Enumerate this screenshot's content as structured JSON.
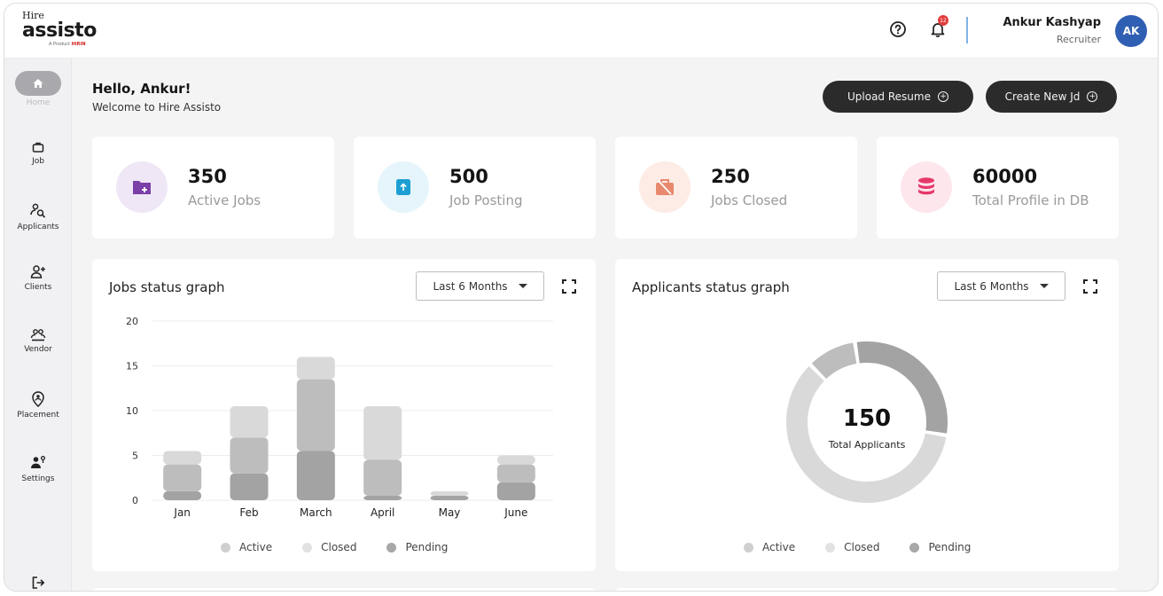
{
  "brand": {
    "hire": "Hire",
    "name": "assisto",
    "tagline_prefix": "A Product",
    "tagline_brand": "HIRIN"
  },
  "header": {
    "notification_count": "12",
    "user_name": "Ankur Kashyap",
    "user_role": "Recruiter",
    "avatar_initials": "AK"
  },
  "sidebar": {
    "items": [
      {
        "label": "Home",
        "icon": "home-icon"
      },
      {
        "label": "Job",
        "icon": "briefcase-icon"
      },
      {
        "label": "Applicants",
        "icon": "applicants-search-icon"
      },
      {
        "label": "Clients",
        "icon": "add-user-icon"
      },
      {
        "label": "Vendor",
        "icon": "group-icon"
      },
      {
        "label": "Placement",
        "icon": "placement-pin-icon"
      },
      {
        "label": "Settings",
        "icon": "user-settings-icon"
      }
    ],
    "logout_icon": "logout-icon"
  },
  "greeting": {
    "hello": "Hello, Ankur!",
    "welcome": "Welcome to Hire Assisto"
  },
  "actions": {
    "upload": "Upload Resume",
    "create": "Create New Jd"
  },
  "stats": [
    {
      "value": "350",
      "label": "Active Jobs",
      "color": "#efe7f6",
      "icon_color": "#7b3fa8"
    },
    {
      "value": "500",
      "label": "Job Posting",
      "color": "#e5f5fb",
      "icon_color": "#1d9fd4"
    },
    {
      "value": "250",
      "label": "Jobs Closed",
      "color": "#fdebe6",
      "icon_color": "#e8896e"
    },
    {
      "value": "60000",
      "label": "Total Profile in DB",
      "color": "#fde6ec",
      "icon_color": "#e6386a"
    }
  ],
  "jobs_panel": {
    "title": "Jobs status graph",
    "range": "Last 6 Months"
  },
  "applicants_panel": {
    "title": "Applicants status graph",
    "range": "Last 6 Months",
    "center_value": "150",
    "center_label": "Total Applicants"
  },
  "legend": [
    "Active",
    "Closed",
    "Pending"
  ],
  "chart_data": [
    {
      "type": "bar",
      "stacked": true,
      "title": "Jobs status graph",
      "categories": [
        "Jan",
        "Feb",
        "March",
        "April",
        "May",
        "June"
      ],
      "ylim": [
        0,
        20
      ],
      "yticks": [
        0,
        5,
        10,
        15,
        20
      ],
      "grid": true,
      "legend_position": "bottom",
      "series": [
        {
          "name": "Pending",
          "values": [
            1,
            3,
            5.5,
            0.5,
            0.5,
            2
          ],
          "color": "#a3a3a3"
        },
        {
          "name": "Closed",
          "values": [
            3,
            4,
            8,
            4,
            0,
            2
          ],
          "color": "#bdbdbd"
        },
        {
          "name": "Active",
          "values": [
            1.5,
            3.5,
            2.5,
            6,
            0.5,
            1
          ],
          "color": "#d9d9d9"
        }
      ]
    },
    {
      "type": "pie",
      "donut": true,
      "title": "Applicants status graph",
      "total": 150,
      "legend_position": "bottom",
      "series": [
        {
          "name": "Active",
          "value": 45,
          "color": "#a3a3a3"
        },
        {
          "name": "Closed",
          "value": 90,
          "color": "#d9d9d9"
        },
        {
          "name": "Pending",
          "value": 15,
          "color": "#bdbdbd"
        }
      ]
    }
  ]
}
